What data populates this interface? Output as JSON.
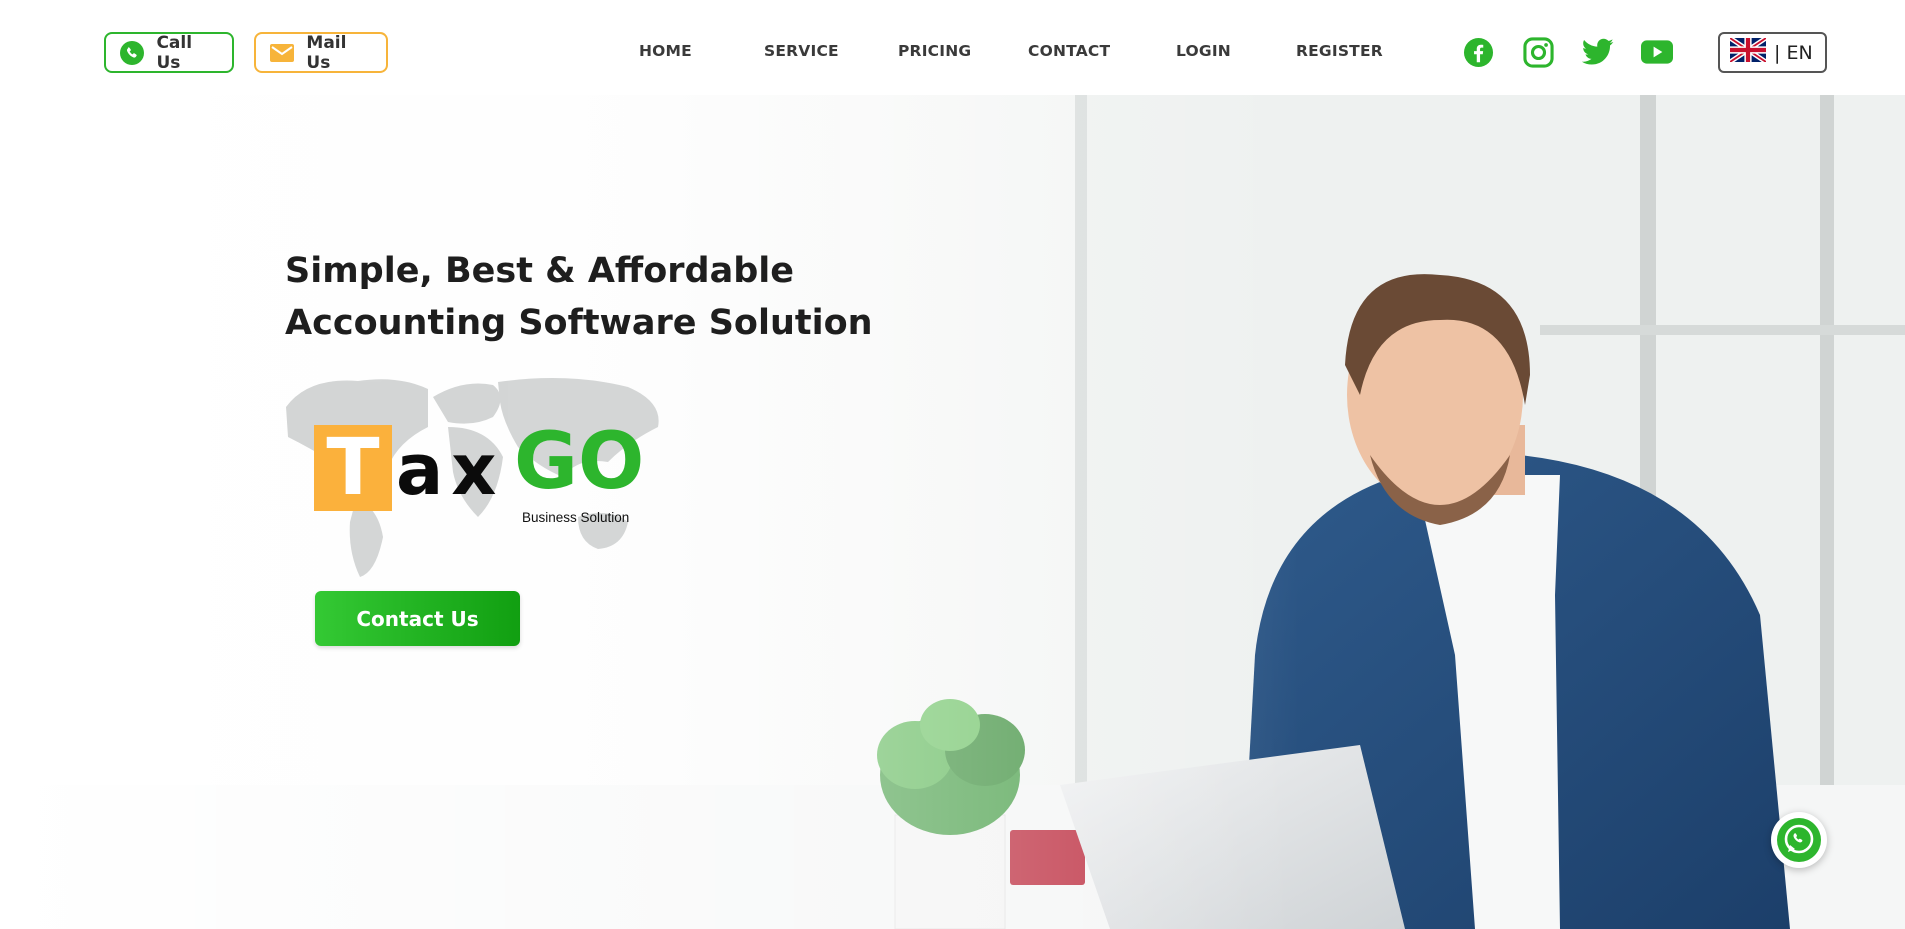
{
  "header": {
    "call_label": "Call Us",
    "mail_label": "Mail Us",
    "nav": [
      "HOME",
      "SERVICE",
      "PRICING",
      "CONTACT",
      "LOGIN",
      "REGISTER"
    ],
    "social_icons": [
      "facebook-icon",
      "instagram-icon",
      "twitter-icon",
      "youtube-icon"
    ],
    "language": "| EN",
    "language_flag": "uk-flag-icon"
  },
  "hero": {
    "headline_line1": "Simple, Best & Affordable",
    "headline_line2": "Accounting Software Solution",
    "logo": {
      "letter_t": "T",
      "letters_ax": "ax",
      "letters_go": "GO",
      "tagline": "Business Solution"
    },
    "cta_label": "Contact Us"
  },
  "colors": {
    "brand_green": "#2db52d",
    "brand_orange": "#fbb13c",
    "text_dark": "#1e1e1e"
  },
  "floating": {
    "whatsapp_icon": "whatsapp-icon"
  }
}
